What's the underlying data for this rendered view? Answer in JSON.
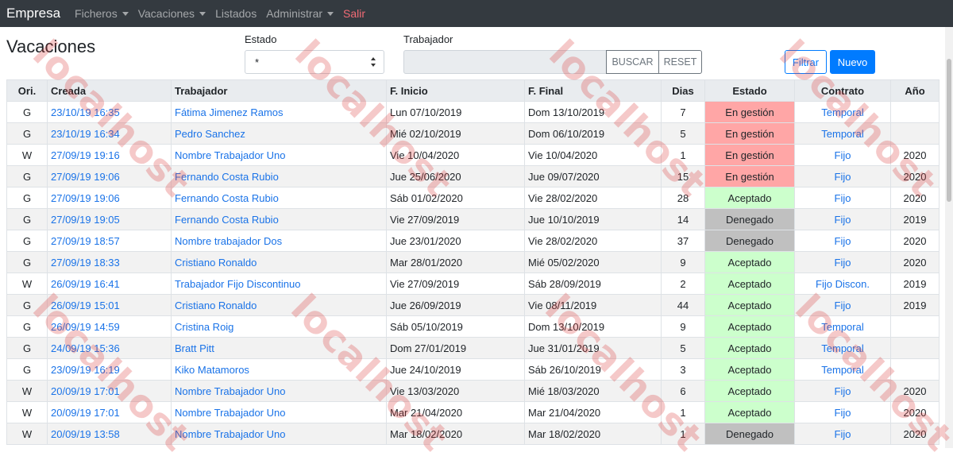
{
  "navbar": {
    "brand": "Empresa",
    "items": [
      {
        "label": "Ficheros",
        "dropdown": true
      },
      {
        "label": "Vacaciones",
        "dropdown": true
      },
      {
        "label": "Listados",
        "dropdown": false
      },
      {
        "label": "Administrar",
        "dropdown": true
      },
      {
        "label": "Salir",
        "dropdown": false
      }
    ]
  },
  "page": {
    "title": "Vacaciones"
  },
  "filters": {
    "estado_label": "Estado",
    "estado_value": "*",
    "trabajador_label": "Trabajador",
    "trabajador_value": "",
    "buscar_label": "BUSCAR",
    "reset_label": "RESET",
    "filtrar_label": "Filtrar",
    "nuevo_label": "Nuevo"
  },
  "table": {
    "headers": [
      "Ori.",
      "Creada",
      "Trabajador",
      "F. Inicio",
      "F. Final",
      "Dias",
      "Estado",
      "Contrato",
      "Año"
    ],
    "rows": [
      {
        "ori": "G",
        "creada": "23/10/19 16:35",
        "trabajador": "Fátima Jimenez Ramos",
        "inicio": "Lun 07/10/2019",
        "final": "Dom 13/10/2019",
        "dias": "7",
        "estado": "En gestión",
        "contrato": "Temporal",
        "anio": ""
      },
      {
        "ori": "G",
        "creada": "23/10/19 16:34",
        "trabajador": "Pedro Sanchez",
        "inicio": "Mié 02/10/2019",
        "final": "Dom 06/10/2019",
        "dias": "5",
        "estado": "En gestión",
        "contrato": "Temporal",
        "anio": ""
      },
      {
        "ori": "W",
        "creada": "27/09/19 19:16",
        "trabajador": "Nombre Trabajador Uno",
        "inicio": "Vie 10/04/2020",
        "final": "Vie 10/04/2020",
        "dias": "1",
        "estado": "En gestión",
        "contrato": "Fijo",
        "anio": "2020"
      },
      {
        "ori": "G",
        "creada": "27/09/19 19:06",
        "trabajador": "Fernando Costa Rubio",
        "inicio": "Jue 25/06/2020",
        "final": "Jue 09/07/2020",
        "dias": "15",
        "estado": "En gestión",
        "contrato": "Fijo",
        "anio": "2020"
      },
      {
        "ori": "G",
        "creada": "27/09/19 19:06",
        "trabajador": "Fernando Costa Rubio",
        "inicio": "Sáb 01/02/2020",
        "final": "Vie 28/02/2020",
        "dias": "28",
        "estado": "Aceptado",
        "contrato": "Fijo",
        "anio": "2020"
      },
      {
        "ori": "G",
        "creada": "27/09/19 19:05",
        "trabajador": "Fernando Costa Rubio",
        "inicio": "Vie 27/09/2019",
        "final": "Jue 10/10/2019",
        "dias": "14",
        "estado": "Denegado",
        "contrato": "Fijo",
        "anio": "2019"
      },
      {
        "ori": "G",
        "creada": "27/09/19 18:57",
        "trabajador": "Nombre trabajador Dos",
        "inicio": "Jue 23/01/2020",
        "final": "Vie 28/02/2020",
        "dias": "37",
        "estado": "Denegado",
        "contrato": "Fijo",
        "anio": "2020"
      },
      {
        "ori": "G",
        "creada": "27/09/19 18:33",
        "trabajador": "Cristiano Ronaldo",
        "inicio": "Mar 28/01/2020",
        "final": "Mié 05/02/2020",
        "dias": "9",
        "estado": "Aceptado",
        "contrato": "Fijo",
        "anio": "2020"
      },
      {
        "ori": "W",
        "creada": "26/09/19 16:41",
        "trabajador": "Trabajador Fijo Discontinuo",
        "inicio": "Vie 27/09/2019",
        "final": "Sáb 28/09/2019",
        "dias": "2",
        "estado": "Aceptado",
        "contrato": "Fijo Discon.",
        "anio": "2019"
      },
      {
        "ori": "G",
        "creada": "26/09/19 15:01",
        "trabajador": "Cristiano Ronaldo",
        "inicio": "Jue 26/09/2019",
        "final": "Vie 08/11/2019",
        "dias": "44",
        "estado": "Aceptado",
        "contrato": "Fijo",
        "anio": "2019"
      },
      {
        "ori": "G",
        "creada": "26/09/19 14:59",
        "trabajador": "Cristina Roig",
        "inicio": "Sáb 05/10/2019",
        "final": "Dom 13/10/2019",
        "dias": "9",
        "estado": "Aceptado",
        "contrato": "Temporal",
        "anio": ""
      },
      {
        "ori": "G",
        "creada": "24/09/19 15:36",
        "trabajador": "Bratt Pitt",
        "inicio": "Dom 27/01/2019",
        "final": "Jue 31/01/2019",
        "dias": "5",
        "estado": "Aceptado",
        "contrato": "Temporal",
        "anio": ""
      },
      {
        "ori": "G",
        "creada": "23/09/19 16:19",
        "trabajador": "Kiko Matamoros",
        "inicio": "Jue 24/10/2019",
        "final": "Sáb 26/10/2019",
        "dias": "3",
        "estado": "Aceptado",
        "contrato": "Temporal",
        "anio": ""
      },
      {
        "ori": "W",
        "creada": "20/09/19 17:01",
        "trabajador": "Nombre Trabajador Uno",
        "inicio": "Vie 13/03/2020",
        "final": "Mié 18/03/2020",
        "dias": "6",
        "estado": "Aceptado",
        "contrato": "Fijo",
        "anio": "2020"
      },
      {
        "ori": "W",
        "creada": "20/09/19 17:01",
        "trabajador": "Nombre Trabajador Uno",
        "inicio": "Mar 21/04/2020",
        "final": "Mar 21/04/2020",
        "dias": "1",
        "estado": "Aceptado",
        "contrato": "Fijo",
        "anio": "2020"
      },
      {
        "ori": "W",
        "creada": "20/09/19 13:58",
        "trabajador": "Nombre Trabajador Uno",
        "inicio": "Mar 18/02/2020",
        "final": "Mar 18/02/2020",
        "dias": "1",
        "estado": "Denegado",
        "contrato": "Fijo",
        "anio": "2020"
      }
    ]
  },
  "watermark": {
    "text": "localhost"
  },
  "colors": {
    "navbar_bg": "#343a40",
    "primary": "#007bff",
    "link": "#1a73e8",
    "en_gestion": "#ffa6a6",
    "aceptado": "#ccffcc",
    "denegado": "#c0c0c0",
    "salir": "#f16b75"
  }
}
